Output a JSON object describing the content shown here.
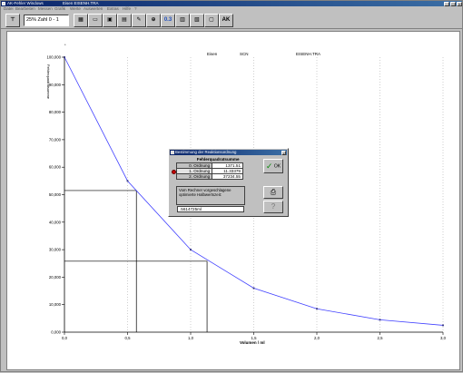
{
  "window": {
    "title_app": "AK-Fehler Windows",
    "title_file": "Eisen EISENH.TRA"
  },
  "menu": [
    "Datei",
    "Bearbeiten",
    "Messen",
    "Grafik",
    "Werte",
    "Auswerten",
    "Extras",
    "Hilfe",
    "?"
  ],
  "toolbar": {
    "zahl_label": "Zahl 0 - 1",
    "zahl_prefix": "25%",
    "badge_03": "0.3",
    "badge_ak": "AK",
    "icons": [
      "ruler-icon",
      "calc-icon",
      "folder-icon",
      "save-icon",
      "print-icon",
      "zoom-icon",
      "pen-icon",
      "table-icon",
      "chart-icon",
      "grid-icon",
      "copy-icon",
      "help-icon"
    ]
  },
  "plot": {
    "header_left": "Eisen",
    "header_mid": "SCN",
    "header_right": "EISENH.TRA",
    "ylabel": "Fehlerquadratsumme",
    "xlabel": "Volumen / ml"
  },
  "chart_data": {
    "type": "line",
    "x": [
      0.0,
      0.5,
      1.0,
      1.5,
      2.0,
      2.5,
      3.0
    ],
    "series": [
      {
        "values": [
          100000,
          55000,
          30000,
          16000,
          8500,
          4500,
          2500
        ],
        "color": "#4040ff"
      }
    ],
    "xlim": [
      0,
      3.0
    ],
    "ylim": [
      0,
      100000
    ],
    "xticks": [
      "0,0",
      "0,5",
      "1,0",
      "1,5",
      "2,0",
      "2,5",
      "3,0"
    ],
    "yticks": [
      "0,000",
      "10,000",
      "20,000",
      "30,000",
      "40,000",
      "50,000",
      "60,000",
      "70,000",
      "80,000",
      "90,000",
      "100,000"
    ],
    "guide_lines": [
      {
        "x": 0.57,
        "y": 51500
      },
      {
        "x": 1.13,
        "y": 25800
      }
    ],
    "grid": "vertical-dotted"
  },
  "dialog": {
    "title": "Bestimmung der Reaktionsordnung",
    "column_header": "Fehlerquadratsumme",
    "rows": [
      {
        "label": "0. Ordnung",
        "value": "1371.51"
      },
      {
        "label": "1. Ordnung",
        "value": "11.33379"
      },
      {
        "label": "2. Ordnung",
        "value": "37234.55"
      }
    ],
    "selected_index": 1,
    "ok_label": "OK",
    "recommend_text": "Vom Rechner vorgeschlagene optimierte Halbwertszeit:",
    "recommend_value": ".5614725ml"
  }
}
